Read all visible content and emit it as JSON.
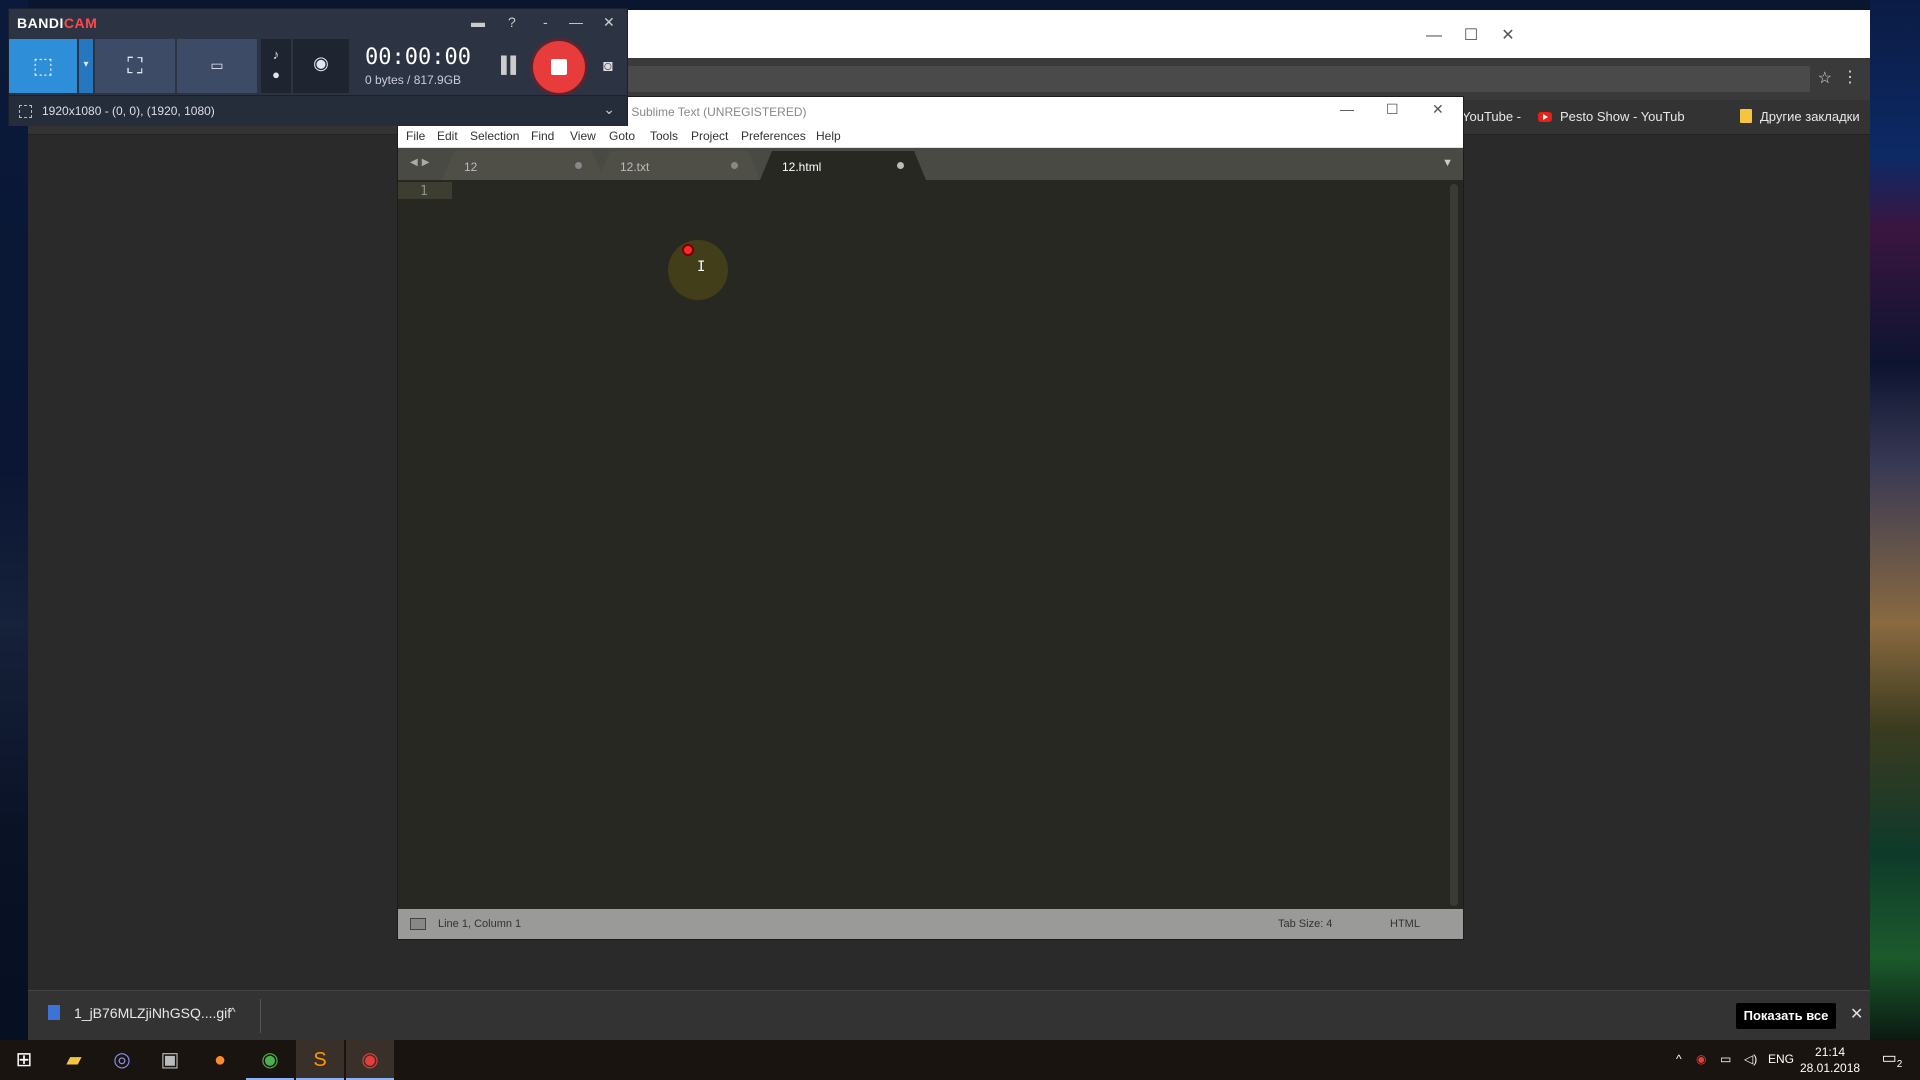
{
  "browser": {
    "bookmarks": [
      {
        "label": "YouTube -",
        "icon": "youtube-icon"
      },
      {
        "label": "Pesto Show - YouTub",
        "icon": "youtube-icon"
      },
      {
        "label": "Другие закладки",
        "icon": "folder-icon"
      }
    ],
    "window_controls": {
      "minimize": "—",
      "maximize": "☐",
      "close": "✕"
    }
  },
  "download_bar": {
    "file_name": "1_jB76MLZjiNhGSQ....gif",
    "show_all": "Показать все",
    "close": "✕"
  },
  "sublime": {
    "title": "- Sublime Text (UNREGISTERED)",
    "menu": [
      "File",
      "Edit",
      "Selection",
      "Find",
      "View",
      "Goto",
      "Tools",
      "Project",
      "Preferences",
      "Help"
    ],
    "tabs": [
      {
        "label": "12",
        "active": false
      },
      {
        "label": "12.txt",
        "active": false
      },
      {
        "label": "12.html",
        "active": true
      }
    ],
    "line_number": "1",
    "status": {
      "position": "Line 1, Column 1",
      "tab_size": "Tab Size: 4",
      "syntax": "HTML"
    }
  },
  "bandicam": {
    "logo_main": "BANDI",
    "logo_accent": "CAM",
    "timer": "00:00:00",
    "size": "0 bytes / 817.9GB",
    "region": "1920x1080 - (0, 0), (1920, 1080)",
    "accent_color": "#2f8ed8",
    "record_color": "#e83b3b"
  },
  "taskbar": {
    "apps": [
      "windows-start-icon",
      "file-explorer-icon",
      "discord-icon",
      "app-icon",
      "firefox-icon",
      "chrome-icon",
      "sublime-text-icon",
      "bandicam-icon"
    ],
    "language": "ENG",
    "time": "21:14",
    "date": "28.01.2018",
    "notification_count": "2"
  }
}
